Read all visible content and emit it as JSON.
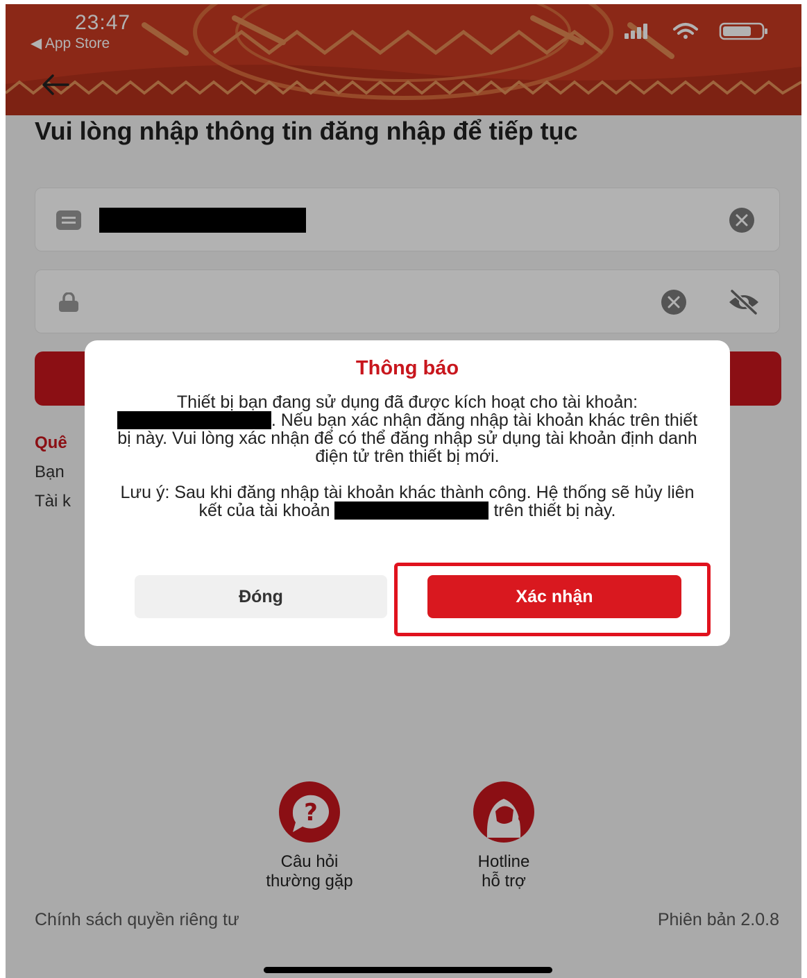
{
  "status_bar": {
    "time": "23:47",
    "back_app": "◀ App Store"
  },
  "page": {
    "title": "Vui lòng nhập thông tin đăng nhập để tiếp tục",
    "forgot_text": "Quê",
    "info_line1": "Bạn",
    "info_line2": "Tài k"
  },
  "username_field": {
    "icon": "id-card-icon"
  },
  "password_field": {
    "icon": "lock-icon",
    "toggle_icon": "eye-slash-icon"
  },
  "dialog": {
    "title": "Thông báo",
    "body_part1": "Thiết bị bạn đang sử dụng đã được kích hoạt cho tài khoản:",
    "body_part2": ". Nếu bạn xác nhận đăng nhập tài khoản khác trên thiết bị này. Vui lòng xác nhận để có thể đăng nhập sử dụng tài khoản định danh điện tử trên thiết bị mới.",
    "note_part1": "Lưu ý: Sau khi đăng nhập tài khoản khác thành công. Hệ thống sẽ hủy liên kết của tài khoản",
    "note_part2": "trên thiết bị này.",
    "close_label": "Đóng",
    "confirm_label": "Xác nhận"
  },
  "support": {
    "faq_line1": "Câu hỏi",
    "faq_line2": "thường gặp",
    "hotline_line1": "Hotline",
    "hotline_line2": "hỗ trợ"
  },
  "footer": {
    "privacy": "Chính sách quyền riêng tư",
    "version": "Phiên bản 2.0.8"
  },
  "colors": {
    "brand_red": "#c8161d",
    "highlight_red": "#e0121e"
  }
}
